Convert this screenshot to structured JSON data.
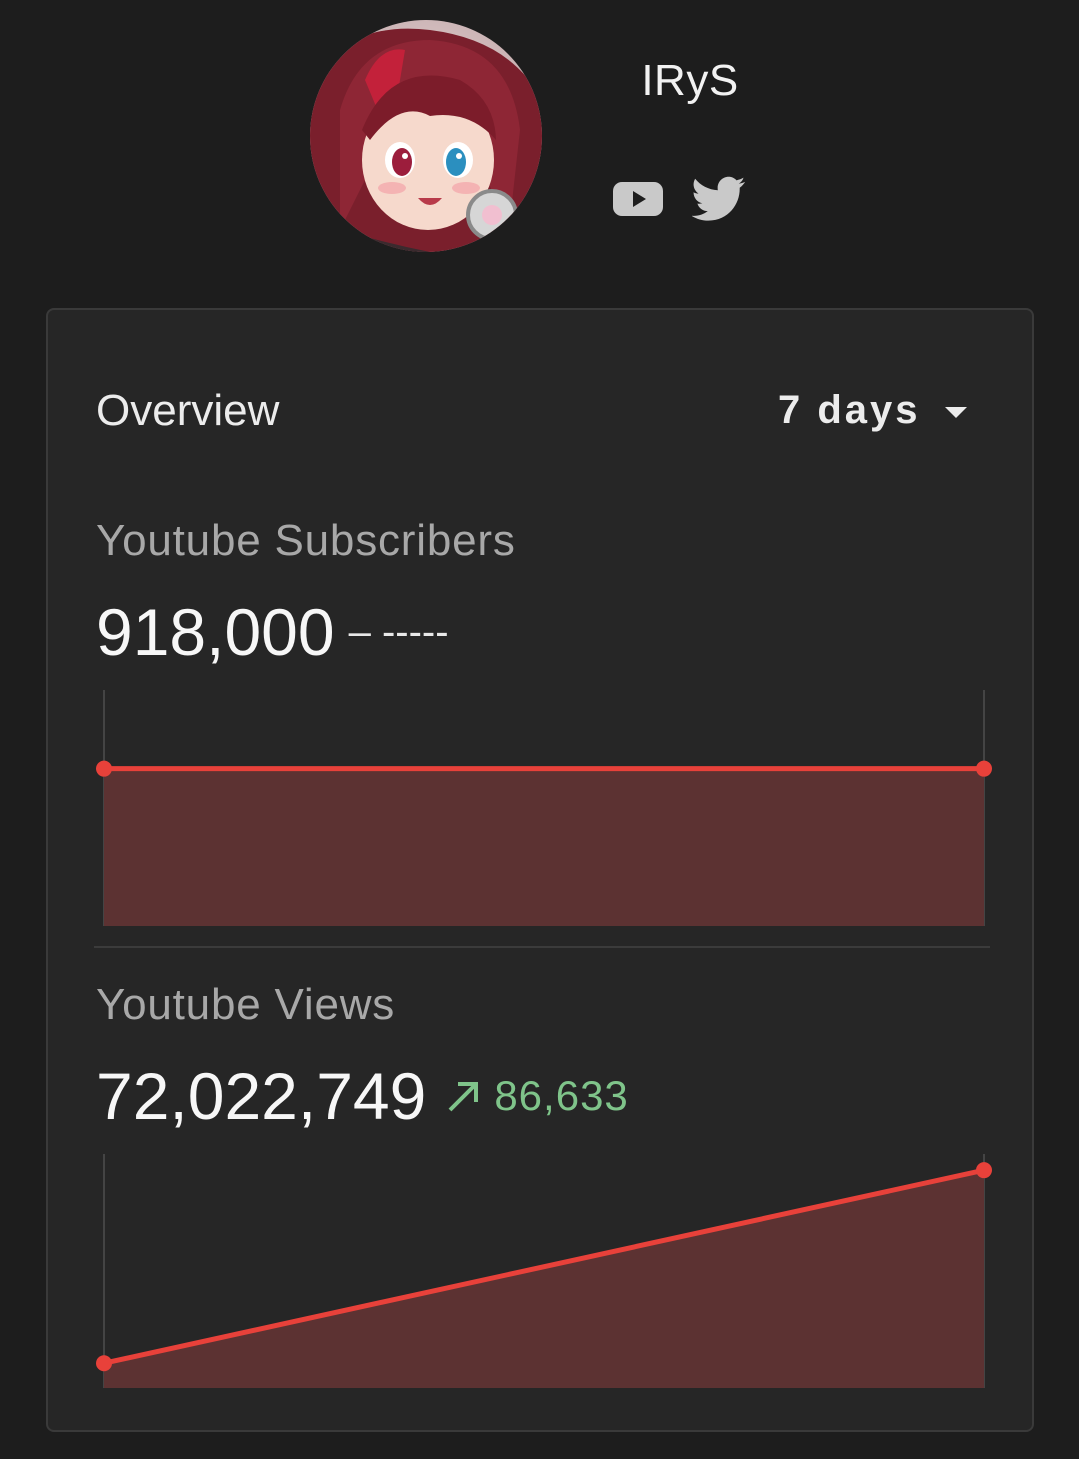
{
  "profile": {
    "name": "IRyS",
    "avatar_icon": "avatar-portrait",
    "links": [
      {
        "icon": "youtube-icon"
      },
      {
        "icon": "twitter-icon"
      }
    ]
  },
  "overview": {
    "title": "Overview",
    "range": "7 days",
    "range_icon": "caret-down-icon"
  },
  "subscribers": {
    "label": "Youtube Subscribers",
    "value": "918,000",
    "delta": "– -----"
  },
  "views": {
    "label": "Youtube Views",
    "value": "72,022,749",
    "delta": "86,633",
    "delta_icon": "trend-up-arrow-icon"
  },
  "colors": {
    "line": "#e8413a",
    "fill": "#5c3232",
    "positive": "#7fc48a",
    "card_bg": "#262626",
    "page_bg": "#1d1d1d"
  },
  "chart_data": [
    {
      "type": "area",
      "title": "Youtube Subscribers",
      "x": [
        0,
        1
      ],
      "series": [
        {
          "values": [
            918000,
            918000
          ]
        }
      ],
      "ylim": [
        917000,
        918500
      ]
    },
    {
      "type": "area",
      "title": "Youtube Views",
      "x": [
        0,
        1
      ],
      "series": [
        {
          "values": [
            71936116,
            72022749
          ]
        }
      ],
      "ylim": [
        71925000,
        72030000
      ]
    }
  ]
}
